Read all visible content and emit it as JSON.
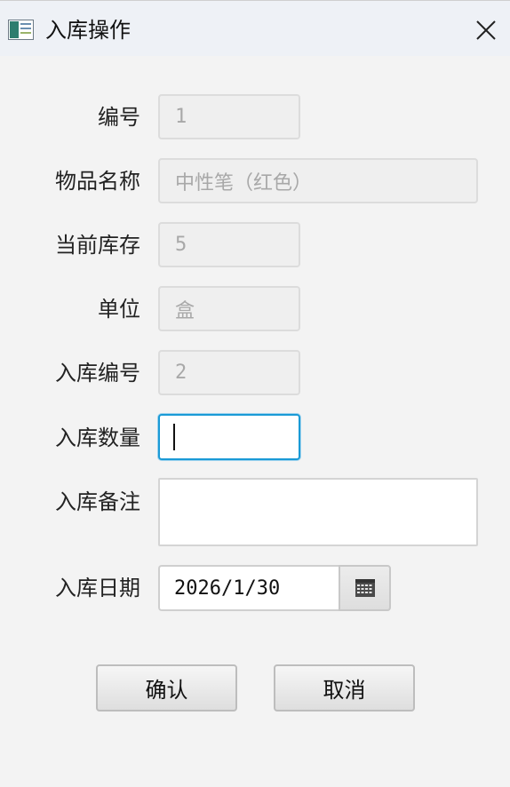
{
  "window": {
    "title": "入库操作",
    "icon": "app-window-icon",
    "close_icon": "close-icon"
  },
  "form": {
    "fields": [
      {
        "label": "编号",
        "value": "1",
        "editable": false
      },
      {
        "label": "物品名称",
        "value": "中性笔（红色）",
        "editable": false
      },
      {
        "label": "当前库存",
        "value": "5",
        "editable": false
      },
      {
        "label": "单位",
        "value": "盒",
        "editable": false
      },
      {
        "label": "入库编号",
        "value": "2",
        "editable": false
      },
      {
        "label": "入库数量",
        "value": "",
        "editable": true,
        "focused": true
      },
      {
        "label": "入库备注",
        "value": "",
        "editable": true
      },
      {
        "label": "入库日期",
        "value": "2026/1/30",
        "editable": true,
        "picker_icon": "calendar-icon"
      }
    ]
  },
  "buttons": {
    "confirm": "确认",
    "cancel": "取消"
  },
  "colors": {
    "focus_border": "#1a9ad6",
    "background": "#f3f3f3",
    "titlebar": "#eef1f6"
  }
}
